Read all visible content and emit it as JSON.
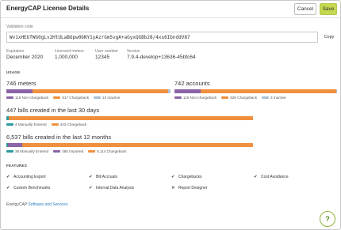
{
  "header": {
    "title": "EnergyCAP License Details",
    "cancel_label": "Cancel",
    "save_label": "Save"
  },
  "validation": {
    "label": "Validation code",
    "code": "Wv1xHEUfWG0gLv2HtULaBOpw0bNY1yAzrGm5vgA+aGyxQGBb28/4xs6IbnddV87",
    "copy_label": "Copy"
  },
  "info": {
    "expiration_label": "Expiration",
    "expiration_value": "December 2020",
    "licensed_meters_label": "Licensed meters",
    "licensed_meters_value": "1,000,000",
    "user_number_label": "User number",
    "user_number_value": "12345",
    "version_label": "Version",
    "version_value": "7.9.4-develop+13636-45bfc64"
  },
  "usage": {
    "section_title": "USAGE",
    "meters": {
      "title": "746 meters",
      "segments": [
        119,
        617,
        10
      ],
      "legend": [
        {
          "label": "119 Non-chargeback",
          "color": "#8a63a8"
        },
        {
          "label": "617 Chargeback",
          "color": "#f0903f"
        },
        {
          "label": "10 Inactive",
          "color": "#a9c2d6"
        }
      ]
    },
    "accounts": {
      "title": "742 accounts",
      "segments": [
        119,
        620,
        3
      ],
      "legend": [
        {
          "label": "119 Non-chargeback",
          "color": "#8a63a8"
        },
        {
          "label": "620 Chargeback",
          "color": "#f0903f"
        },
        {
          "label": "3 Inactive",
          "color": "#a9c2d6"
        }
      ]
    },
    "bills30": {
      "title": "447 bills created in the last 30 days",
      "segments": [
        4,
        443
      ],
      "legend": [
        {
          "label": "4 Manually Entered",
          "color": "#2a9aa0"
        },
        {
          "label": "443 Chargeback",
          "color": "#f0903f"
        }
      ]
    },
    "bills12": {
      "title": "6,537 bills created in the last 12 months",
      "segments": [
        38,
        385,
        6114
      ],
      "legend": [
        {
          "label": "38 Manually Entered",
          "color": "#2a9aa0"
        },
        {
          "label": "385 Imported",
          "color": "#8a63a8"
        },
        {
          "label": "6,114 Chargeback",
          "color": "#f0903f"
        }
      ]
    }
  },
  "features": {
    "section_title": "FEATURES",
    "items": [
      {
        "label": "Accounting Export",
        "enabled": true
      },
      {
        "label": "Bill Accruals",
        "enabled": true
      },
      {
        "label": "Chargebacks",
        "enabled": true
      },
      {
        "label": "Cost Avoidance",
        "enabled": true
      },
      {
        "label": "Custom Benchmarks",
        "enabled": true
      },
      {
        "label": "Interval Data Analysis",
        "enabled": true
      },
      {
        "label": "Report Designer",
        "enabled": false
      }
    ]
  },
  "footer": {
    "prefix": "EnergyCAP ",
    "link_text": "Software and Services"
  },
  "help_label": "?"
}
